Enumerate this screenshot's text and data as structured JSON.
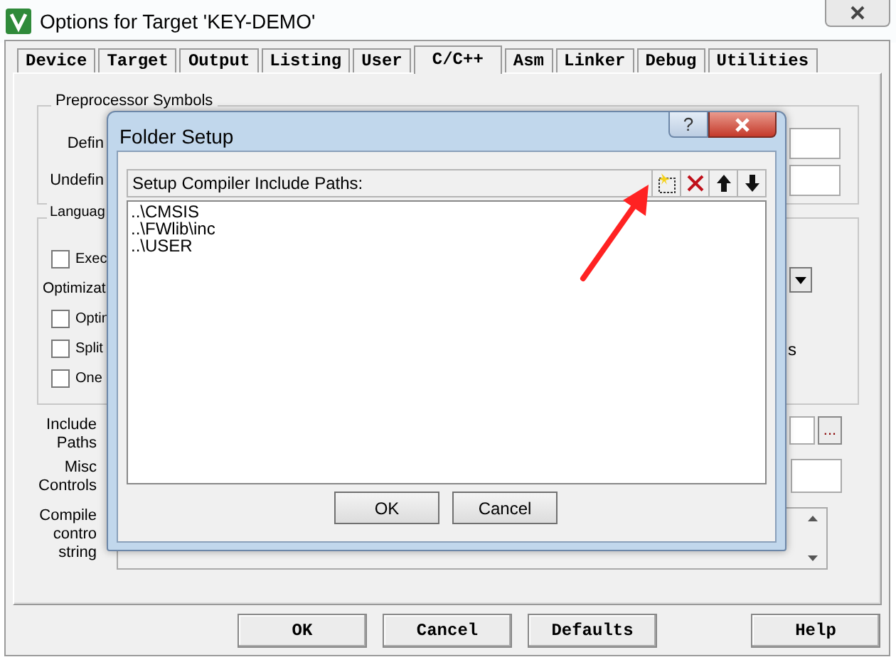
{
  "window": {
    "title": "Options for Target 'KEY-DEMO'"
  },
  "tabs": [
    {
      "label": "Device",
      "selected": false
    },
    {
      "label": "Target",
      "selected": false
    },
    {
      "label": "Output",
      "selected": false
    },
    {
      "label": "Listing",
      "selected": false
    },
    {
      "label": "User",
      "selected": false
    },
    {
      "label": "C/C++",
      "selected": true
    },
    {
      "label": "Asm",
      "selected": false
    },
    {
      "label": "Linker",
      "selected": false
    },
    {
      "label": "Debug",
      "selected": false
    },
    {
      "label": "Utilities",
      "selected": false
    }
  ],
  "preprocessor": {
    "title": "Preprocessor Symbols",
    "define_label": "Defin",
    "undefine_label": "Undefin"
  },
  "language": {
    "title": "Languag",
    "checkboxes": [
      {
        "label": "Exec",
        "checked": false
      }
    ],
    "optimization_label": "Optimizat",
    "options": [
      {
        "label": "Optin",
        "checked": false
      },
      {
        "label": "Split",
        "checked": false
      },
      {
        "label": "One",
        "checked": false
      }
    ],
    "side_text": "s"
  },
  "include_paths": {
    "label": [
      "Include",
      "Paths"
    ],
    "browse": "..."
  },
  "misc_controls": {
    "label": [
      "Misc",
      "Controls"
    ]
  },
  "compiler_string": {
    "label": [
      "Compile",
      "contro",
      "string"
    ]
  },
  "buttons": [
    "OK",
    "Cancel",
    "Defaults",
    "Help"
  ],
  "folder_setup": {
    "title": "Folder Setup",
    "help": "?",
    "header": "Setup Compiler Include Paths:",
    "tools": [
      {
        "kind": "new"
      },
      {
        "kind": "delete"
      },
      {
        "kind": "up"
      },
      {
        "kind": "down"
      }
    ],
    "paths": [
      "..\\CMSIS",
      "..\\FWlib\\inc",
      "..\\USER"
    ],
    "buttons": [
      "OK",
      "Cancel"
    ]
  },
  "annotation": {
    "kind": "arrow"
  }
}
